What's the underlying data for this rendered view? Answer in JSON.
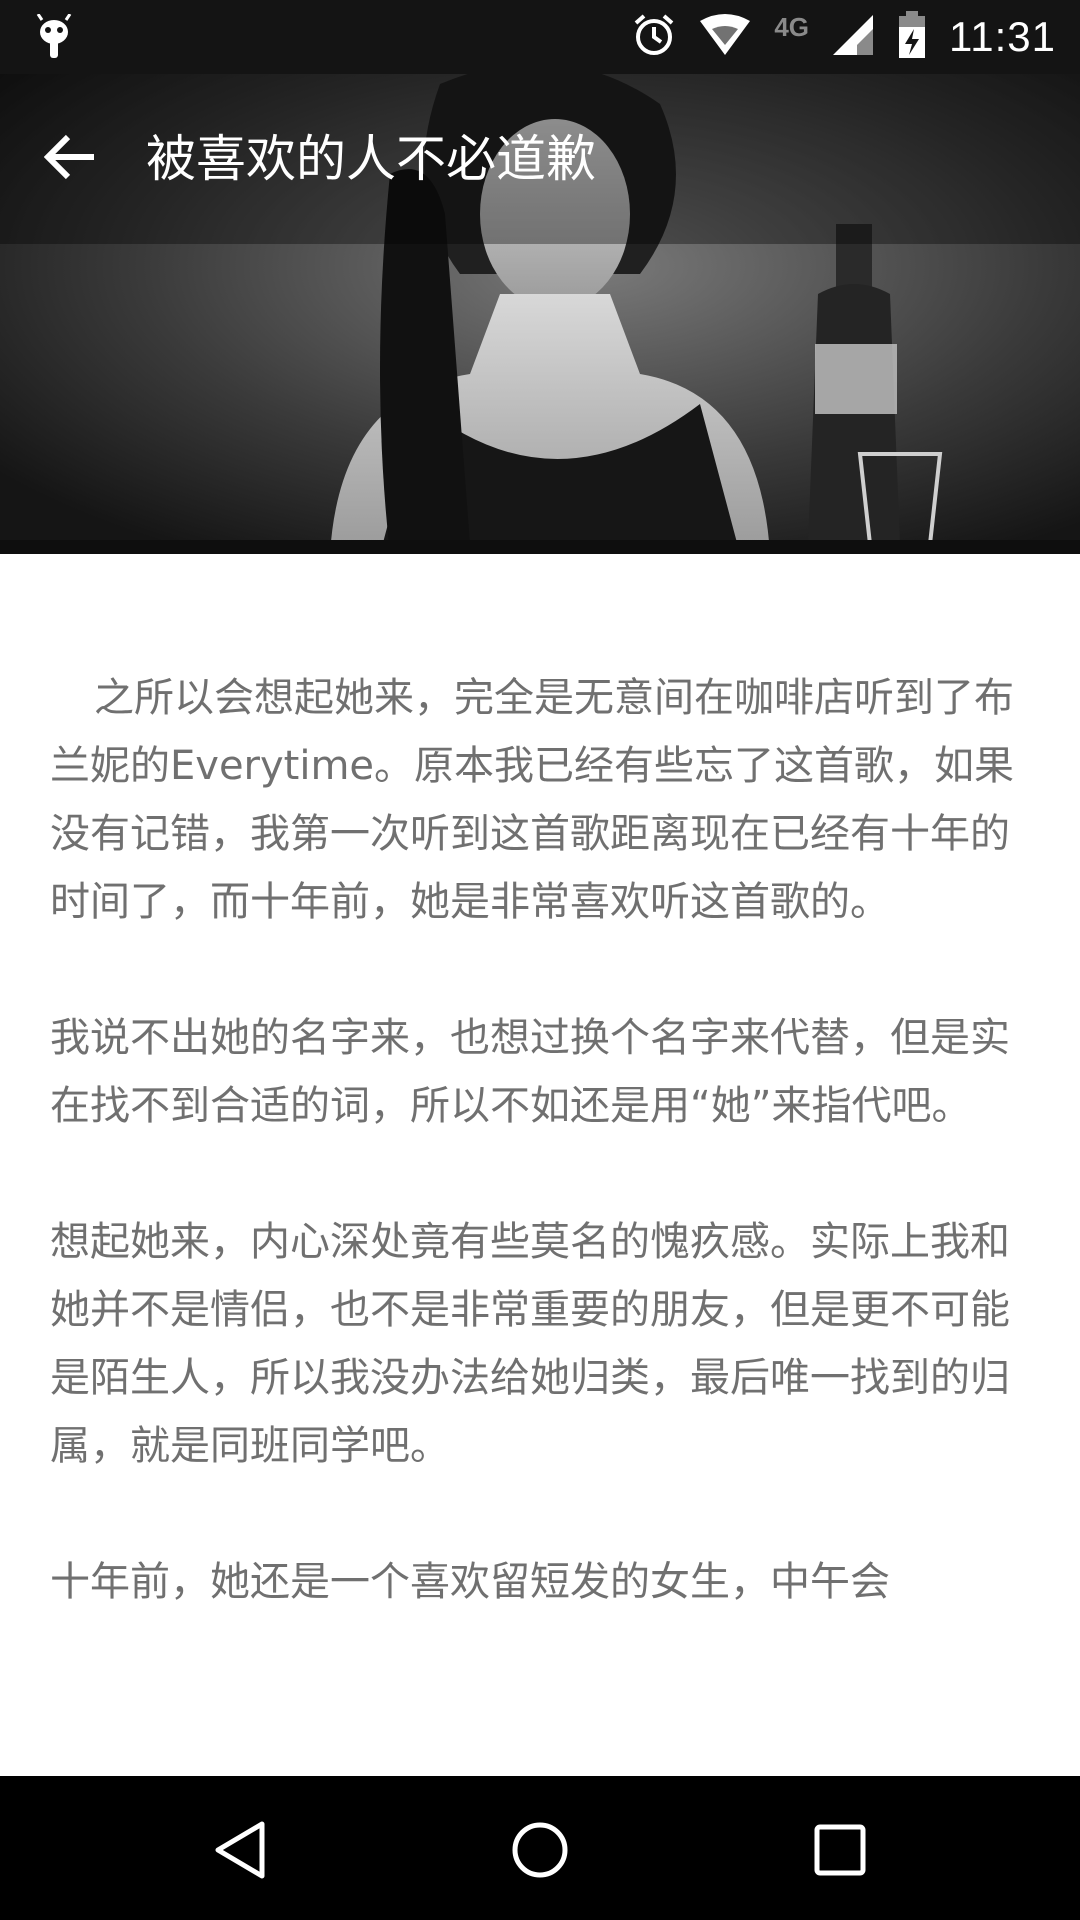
{
  "status_bar": {
    "time": "11:31",
    "network": "4G",
    "icons": [
      "android-debug-icon",
      "alarm-icon",
      "wifi-icon",
      "signal-icon",
      "battery-charging-icon"
    ]
  },
  "toolbar": {
    "title": "被喜欢的人不必道歉",
    "back_icon": "arrow-back-icon"
  },
  "article": {
    "paragraphs": [
      "之所以会想起她来，完全是无意间在咖啡店听到了布兰妮的Everytime。原本我已经有些忘了这首歌，如果没有记错，我第一次听到这首歌距离现在已经有十年的时间了，而十年前，她是非常喜欢听这首歌的。",
      "我说不出她的名字来，也想过换个名字来代替，但是实在找不到合适的词，所以不如还是用“她”来指代吧。",
      "想起她来，内心深处竟有些莫名的愧疚感。实际上我和她并不是情侣，也不是非常重要的朋友，但是更不可能是陌生人，所以我没办法给她归类，最后唯一找到的归属，就是同班同学吧。",
      "十年前，她还是一个喜欢留短发的女生，中午会"
    ]
  },
  "nav_bar": {
    "icons": [
      "back-triangle-icon",
      "home-circle-icon",
      "recents-square-icon"
    ]
  }
}
